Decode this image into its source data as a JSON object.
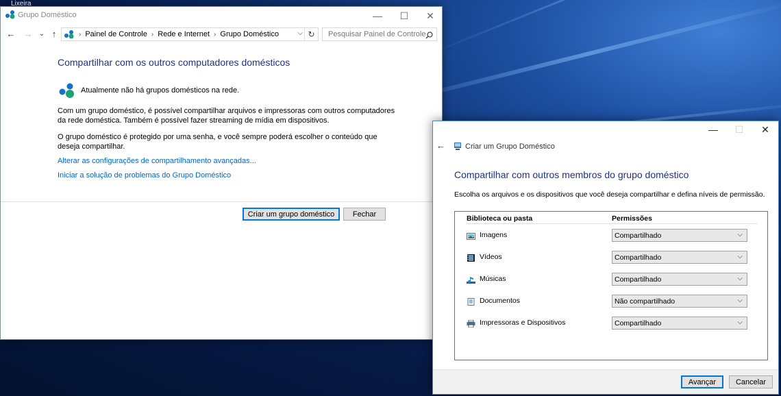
{
  "desktop": {
    "top_label": "Lixeira"
  },
  "window1": {
    "title": "Grupo Doméstico",
    "caption": {
      "minimize": "—",
      "maximize": "☐",
      "close": "✕"
    },
    "nav": {
      "back": "←",
      "forward": "→",
      "recent": "⌄",
      "up": "↑"
    },
    "breadcrumb": [
      "Painel de Controle",
      "Rede e Internet",
      "Grupo Doméstico"
    ],
    "breadcrumb_sep": "›",
    "address_dropdown": "⌵",
    "refresh": "↻",
    "search_placeholder": "Pesquisar Painel de Controle",
    "heading": "Compartilhar com os outros computadores domésticos",
    "status": "Atualmente não há grupos domésticos na rede.",
    "para1": "Com um grupo doméstico, é possível compartilhar arquivos e impressoras com outros computadores da rede doméstica. Também é possível fazer streaming de mídia em dispositivos.",
    "para2": "O grupo doméstico é protegido por uma senha, e você sempre poderá escolher o conteúdo que deseja compartilhar.",
    "link1": "Alterar as configurações de compartilhamento avançadas...",
    "link2": "Iniciar a solução de problemas do Grupo Doméstico",
    "create_button": "Criar um grupo doméstico",
    "close_button": "Fechar"
  },
  "window2": {
    "caption": {
      "minimize": "—",
      "maximize": "☐",
      "close": "✕"
    },
    "back": "←",
    "title": "Criar um Grupo Doméstico",
    "heading": "Compartilhar com outros membros do grupo doméstico",
    "description": "Escolha os arquivos e os dispositivos que você deseja compartilhar e defina níveis de permissão.",
    "col_library": "Biblioteca ou pasta",
    "col_permissions": "Permissões",
    "select_chevron": "⌵",
    "rows": [
      {
        "label": "Imagens",
        "permission": "Compartilhado",
        "icon": "pictures-icon"
      },
      {
        "label": "Vídeos",
        "permission": "Compartilhado",
        "icon": "videos-icon"
      },
      {
        "label": "Músicas",
        "permission": "Compartilhado",
        "icon": "music-icon"
      },
      {
        "label": "Documentos",
        "permission": "Não compartilhado",
        "icon": "documents-icon"
      },
      {
        "label": "Impressoras e Dispositivos",
        "permission": "Compartilhado",
        "icon": "printer-icon"
      }
    ],
    "next_button": "Avançar",
    "cancel_button": "Cancelar"
  },
  "colors": {
    "heading": "#1e3287",
    "link": "#0066cc",
    "accent": "#0078d7",
    "homegroup_green": "#1aa27a",
    "homegroup_blue": "#1570c7"
  }
}
